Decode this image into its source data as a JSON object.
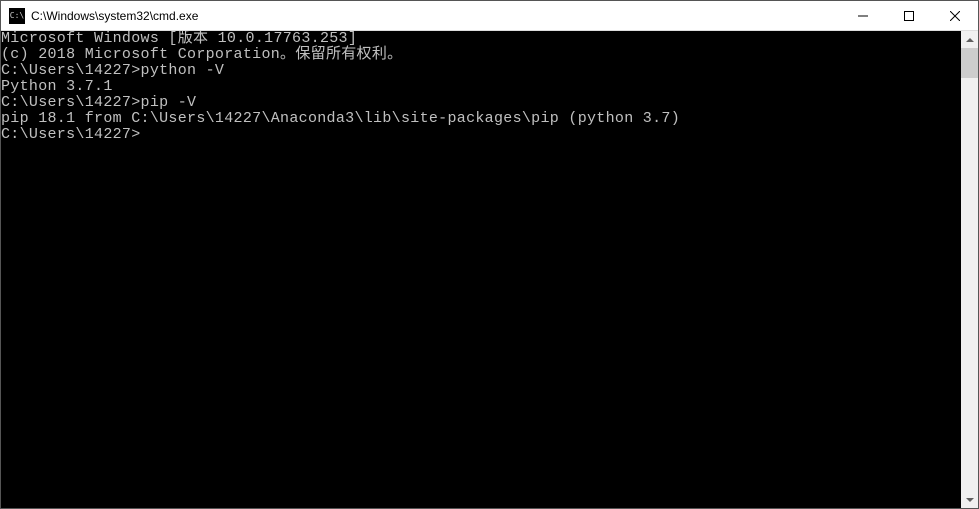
{
  "window": {
    "title": "C:\\Windows\\system32\\cmd.exe",
    "icon_text": "C:\\"
  },
  "terminal": {
    "lines": [
      "Microsoft Windows [版本 10.0.17763.253]",
      "(c) 2018 Microsoft Corporation。保留所有权利。",
      "",
      "C:\\Users\\14227>python -V",
      "Python 3.7.1",
      "",
      "C:\\Users\\14227>pip -V",
      "pip 18.1 from C:\\Users\\14227\\Anaconda3\\lib\\site-packages\\pip (python 3.7)",
      "",
      "C:\\Users\\14227>"
    ]
  }
}
